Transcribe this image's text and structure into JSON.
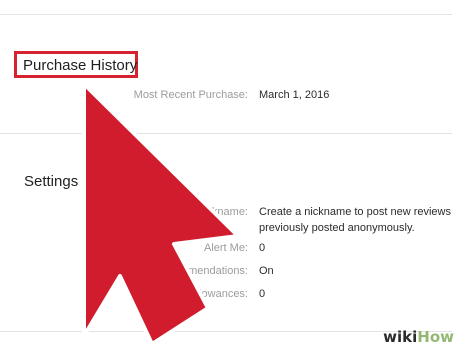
{
  "purchase_history": {
    "heading": "Purchase History",
    "most_recent_label": "Most Recent Purchase:",
    "most_recent_value": "March 1, 2016"
  },
  "settings": {
    "heading": "Settings",
    "rows": [
      {
        "label": "Nickname:",
        "value": "Create a nickname to post new reviews",
        "value_line2": "previously posted anonymously."
      },
      {
        "label": "Alert Me:",
        "value": "0"
      },
      {
        "label": "mendations:",
        "value": "On"
      },
      {
        "label": "Allowances:",
        "value": "0"
      }
    ]
  },
  "watermark": {
    "part1": "wiki",
    "part2": "How"
  },
  "colors": {
    "highlight": "#d6212e",
    "arrow_fill": "#d01c2d",
    "arrow_stroke": "#ffffff",
    "brand_green": "#93b874"
  },
  "icons": {
    "pointer": "red-arrow-pointer-icon"
  }
}
